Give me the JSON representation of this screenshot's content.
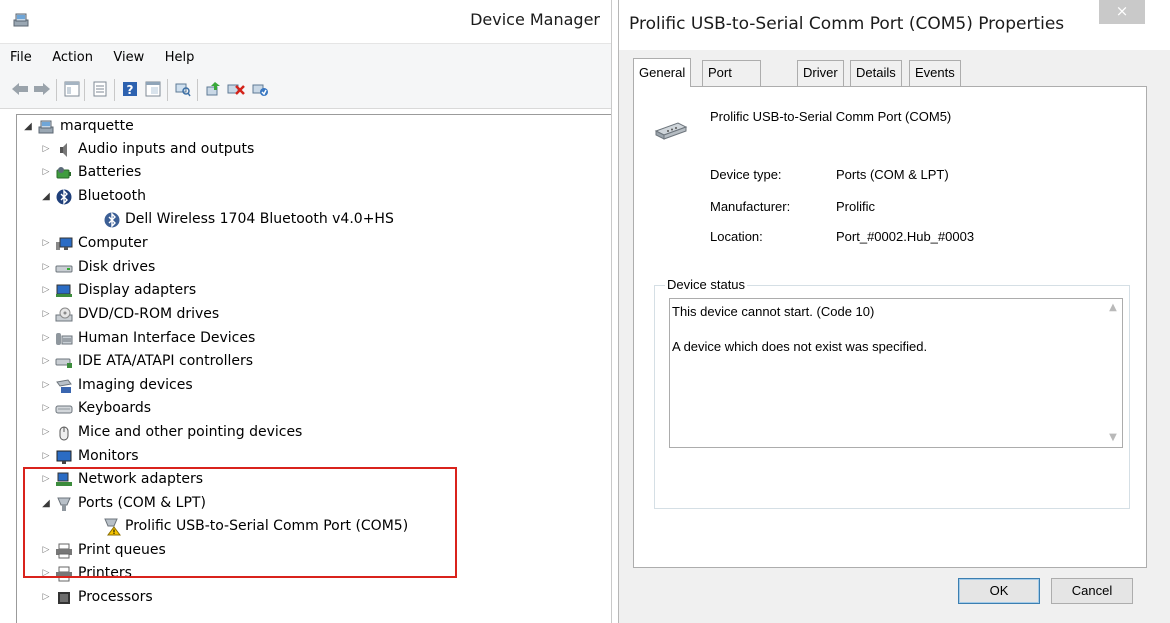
{
  "device_manager": {
    "title": "Device Manager",
    "menu": [
      "File",
      "Action",
      "View",
      "Help"
    ],
    "tree": [
      {
        "label": "marquette",
        "icon": "computer-icon",
        "expanded": true,
        "level": 0
      },
      {
        "label": "Audio inputs and outputs",
        "icon": "speaker-icon",
        "expanded": false,
        "level": 1
      },
      {
        "label": "Batteries",
        "icon": "battery-icon",
        "expanded": false,
        "level": 1
      },
      {
        "label": "Bluetooth",
        "icon": "bluetooth-icon",
        "expanded": true,
        "level": 1
      },
      {
        "label": "Dell Wireless 1704 Bluetooth v4.0+HS",
        "icon": "bluetooth-device-icon",
        "level": 2
      },
      {
        "label": "Computer",
        "icon": "monitor-icon",
        "expanded": false,
        "level": 1
      },
      {
        "label": "Disk drives",
        "icon": "disk-icon",
        "expanded": false,
        "level": 1
      },
      {
        "label": "Display adapters",
        "icon": "display-adapter-icon",
        "expanded": false,
        "level": 1
      },
      {
        "label": "DVD/CD-ROM drives",
        "icon": "dvd-icon",
        "expanded": false,
        "level": 1
      },
      {
        "label": "Human Interface Devices",
        "icon": "hid-icon",
        "expanded": false,
        "level": 1
      },
      {
        "label": "IDE ATA/ATAPI controllers",
        "icon": "ide-icon",
        "expanded": false,
        "level": 1
      },
      {
        "label": "Imaging devices",
        "icon": "camera-icon",
        "expanded": false,
        "level": 1
      },
      {
        "label": "Keyboards",
        "icon": "keyboard-icon",
        "expanded": false,
        "level": 1
      },
      {
        "label": "Mice and other pointing devices",
        "icon": "mouse-icon",
        "expanded": false,
        "level": 1
      },
      {
        "label": "Monitors",
        "icon": "monitor-icon",
        "expanded": false,
        "level": 1
      },
      {
        "label": "Network adapters",
        "icon": "network-icon",
        "expanded": false,
        "level": 1
      },
      {
        "label": "Ports (COM & LPT)",
        "icon": "port-icon",
        "expanded": true,
        "level": 1
      },
      {
        "label": "Prolific USB-to-Serial Comm Port (COM5)",
        "icon": "warning-port-icon",
        "level": 2
      },
      {
        "label": "Print queues",
        "icon": "printer-icon",
        "expanded": false,
        "level": 1
      },
      {
        "label": "Printers",
        "icon": "printer-icon",
        "expanded": false,
        "level": 1
      },
      {
        "label": "Processors",
        "icon": "processor-icon",
        "expanded": false,
        "level": 1
      }
    ]
  },
  "properties": {
    "title": "Prolific USB-to-Serial Comm Port (COM5) Properties",
    "close_glyph": "×",
    "tabs": [
      "General",
      "Port Settings",
      "Driver",
      "Details",
      "Events"
    ],
    "selected_tab": "General",
    "device_name": "Prolific USB-to-Serial Comm Port (COM5)",
    "fields": [
      {
        "label": "Device type:",
        "value": "Ports (COM & LPT)"
      },
      {
        "label": "Manufacturer:",
        "value": "Prolific"
      },
      {
        "label": "Location:",
        "value": "Port_#0002.Hub_#0003"
      }
    ],
    "status_legend": "Device status",
    "status_line1": "This device cannot start. (Code 10)",
    "status_line2": "A device which does not exist was specified.",
    "ok_label": "OK",
    "cancel_label": "Cancel"
  },
  "colors": {
    "highlight": "#d9231c"
  }
}
